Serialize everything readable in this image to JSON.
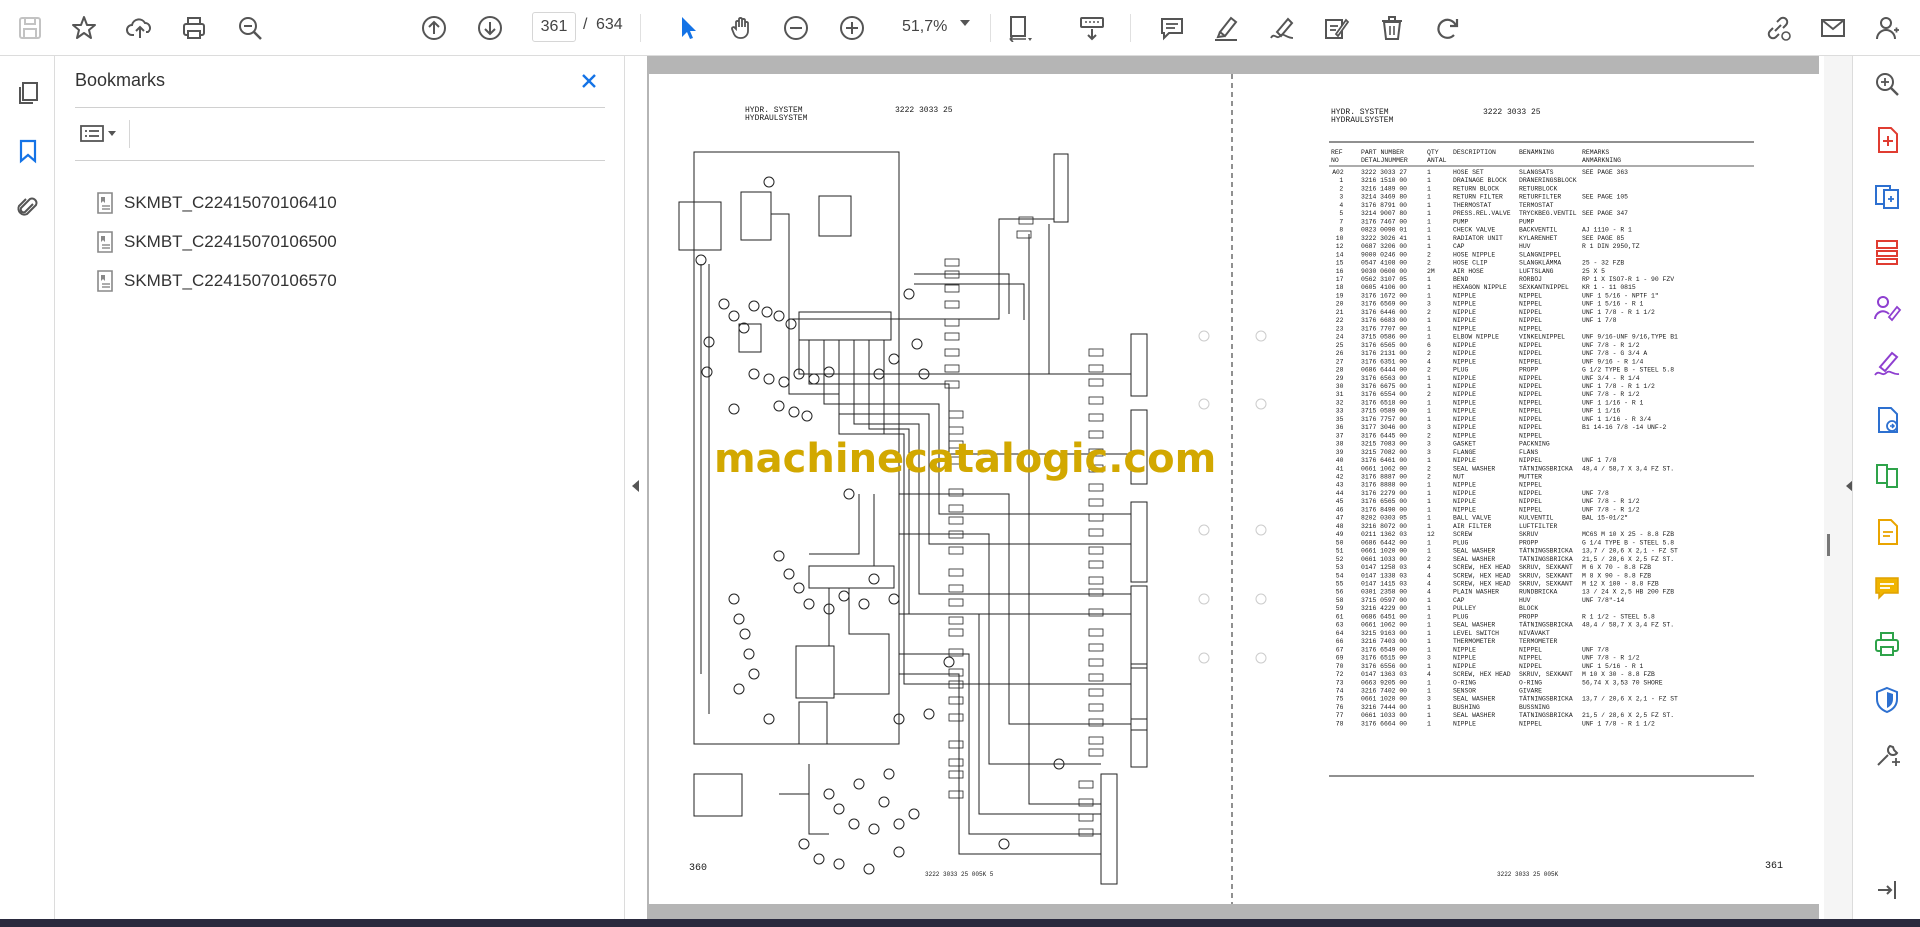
{
  "toolbar": {
    "page_current": "361",
    "page_separator": "/",
    "page_total": "634",
    "zoom": "51,7%"
  },
  "bookmarks": {
    "title": "Bookmarks",
    "items": [
      {
        "label": "SKMBT_C22415070106410"
      },
      {
        "label": "SKMBT_C22415070106500"
      },
      {
        "label": "SKMBT_C22415070106570"
      }
    ]
  },
  "document": {
    "watermark": "machinecatalogic.com",
    "left_page": {
      "header1": "HYDR. SYSTEM",
      "header2": "HYDRAULSYSTEM",
      "part_ref": "3222 3033 25",
      "page_number": "360",
      "footer": "3222 3033 25   005K   5"
    },
    "right_page": {
      "header1": "HYDR. SYSTEM",
      "header2": "HYDRAULSYSTEM",
      "part_ref": "3222 3033 25",
      "page_number": "361",
      "footer": "3222 3033 25   005K",
      "columns": [
        "REF NO",
        "PART NUMBER DETALJNUMMER",
        "QTY ANTAL",
        "DESCRIPTION",
        "BENÄMNING",
        "REMARKS ANMÄRKNING"
      ],
      "rows": [
        [
          "A02",
          "3222 3033 27",
          "1",
          "HOSE SET",
          "SLANGSATS",
          "SEE PAGE 363"
        ],
        [
          "1",
          "3216 1510 00",
          "1",
          "DRAINAGE BLOCK",
          "DRÄNERINGSBLOCK",
          ""
        ],
        [
          "2",
          "3216 1489 00",
          "1",
          "RETURN BLOCK",
          "RETURBLOCK",
          ""
        ],
        [
          "3",
          "3214 3469 80",
          "1",
          "RETURN FILTER",
          "RETURFILTER",
          "SEE PAGE 105"
        ],
        [
          "4",
          "3176 8791 00",
          "1",
          "THERMOSTAT",
          "TERMOSTAT",
          ""
        ],
        [
          "5",
          "3214 9007 80",
          "1",
          "PRESS.REL.VALVE",
          "TRYCKBEG.VENTIL",
          "SEE PAGE 347"
        ],
        [
          "7",
          "3176 7467 00",
          "1",
          "PUMP",
          "PUMP",
          ""
        ],
        [
          "8",
          "0823 0090 01",
          "1",
          "CHECK VALVE",
          "BACKVENTIL",
          "AJ 1110 - R 1"
        ],
        [
          "10",
          "3222 3026 41",
          "1",
          "RADIATOR UNIT",
          "KYLARENHET",
          "SEE PAGE 85"
        ],
        [
          "12",
          "0687 3206 00",
          "1",
          "CAP",
          "HUV",
          "R 1 DIN 2950,TZ"
        ],
        [
          "14",
          "9000 0246 00",
          "2",
          "HOSE NIPPLE",
          "SLANGNIPPEL",
          ""
        ],
        [
          "15",
          "0547 4108 00",
          "2",
          "HOSE CLIP",
          "SLANGKLÄMMA",
          "25 - 32 FZB"
        ],
        [
          "16",
          "9030 0600 00",
          "2M",
          "AIR HOSE",
          "LUFTSLANG",
          "25  X 5"
        ],
        [
          "17",
          "0562 3107 05",
          "1",
          "BEND",
          "RÖRBÖJ",
          "RP 1 X ISO7-R 1 - 90 FZV"
        ],
        [
          "18",
          "0605 4106 00",
          "1",
          "HEXAGON NIPPLE",
          "SEXKANTNIPPEL",
          "KR 1 - 11 0815"
        ],
        [
          "19",
          "3176 1672 00",
          "1",
          "NIPPLE",
          "NIPPEL",
          "UNF 1 5/16 - NPTF 1\""
        ],
        [
          "20",
          "3176 6569 00",
          "3",
          "NIPPLE",
          "NIPPEL",
          "UNF 1 5/16 - R 1"
        ],
        [
          "21",
          "3176 6446 00",
          "2",
          "NIPPLE",
          "NIPPEL",
          "UNF 1 7/8 - R 1 1/2"
        ],
        [
          "22",
          "3176 6683 00",
          "1",
          "NIPPLE",
          "NIPPEL",
          "UNF 1 7/8"
        ],
        [
          "23",
          "3176 7707 00",
          "1",
          "NIPPLE",
          "NIPPEL",
          ""
        ],
        [
          "24",
          "3715 0586 00",
          "1",
          "ELBOW NIPPLE",
          "VINKELNIPPEL",
          "UNF 9/16-UNF 9/16,TYPE B1"
        ],
        [
          "25",
          "3176 6565 00",
          "6",
          "NIPPLE",
          "NIPPEL",
          "UNF 7/8 - R 1/2"
        ],
        [
          "26",
          "3176 2131 00",
          "2",
          "NIPPLE",
          "NIPPEL",
          "UNF 7/8 - G 3/4 A"
        ],
        [
          "27",
          "3176 6351 00",
          "4",
          "NIPPLE",
          "NIPPEL",
          "UNF 9/16 - R 1/4"
        ],
        [
          "28",
          "0686 6444 00",
          "2",
          "PLUG",
          "PROPP",
          "G 1/2 TYPE B - STEEL 5.8"
        ],
        [
          "29",
          "3176 6563 00",
          "1",
          "NIPPLE",
          "NIPPEL",
          "UNF 3/4 - R 1/4"
        ],
        [
          "30",
          "3176 6675 00",
          "1",
          "NIPPLE",
          "NIPPEL",
          "UNF 1 7/8 - R 1 1/2"
        ],
        [
          "31",
          "3176 6554 00",
          "2",
          "NIPPLE",
          "NIPPEL",
          "UNF 7/8 - R 1/2"
        ],
        [
          "32",
          "3176 6518 00",
          "1",
          "NIPPLE",
          "NIPPEL",
          "UNF 1 1/16 - R 1"
        ],
        [
          "33",
          "3715 0589 00",
          "1",
          "NIPPLE",
          "NIPPEL",
          "UNF 1 1/16"
        ],
        [
          "35",
          "3176 7757 00",
          "1",
          "NIPPLE",
          "NIPPEL",
          "UNF 1 1/16 - R 3/4"
        ],
        [
          "36",
          "3177 3046 00",
          "3",
          "NIPPLE",
          "NIPPEL",
          "B1  14-16   7/8 -14 UNF-2"
        ],
        [
          "37",
          "3176 6445 00",
          "2",
          "NIPPLE",
          "NIPPEL",
          ""
        ],
        [
          "38",
          "3215 7083 00",
          "3",
          "GASKET",
          "PACKNING",
          ""
        ],
        [
          "39",
          "3215 7082 00",
          "3",
          "FLANGE",
          "FLÄNS",
          ""
        ],
        [
          "40",
          "3176 6461 00",
          "1",
          "NIPPLE",
          "NIPPEL",
          "UNF 1 7/8"
        ],
        [
          "41",
          "0661 1062 00",
          "2",
          "SEAL WASHER",
          "TÄTNINGSBRICKA",
          "48,4 / 58,7 X 3,4 FZ ST."
        ],
        [
          "42",
          "3176 8887 00",
          "2",
          "NUT",
          "MUTTER",
          ""
        ],
        [
          "43",
          "3176 8888 00",
          "1",
          "NIPPLE",
          "NIPPEL",
          ""
        ],
        [
          "44",
          "3176 2279 00",
          "1",
          "NIPPLE",
          "NIPPEL",
          "UNF 7/8"
        ],
        [
          "45",
          "3176 6565 00",
          "1",
          "NIPPLE",
          "NIPPEL",
          "UNF 7/8 - R 1/2"
        ],
        [
          "46",
          "3176 8490 00",
          "1",
          "NIPPLE",
          "NIPPEL",
          "UNF 7/8 - R 1/2"
        ],
        [
          "47",
          "8202 0303 05",
          "1",
          "BALL VALVE",
          "KULVENTIL",
          "BAL 15-01/2\""
        ],
        [
          "48",
          "3216 8072 00",
          "1",
          "AIR FILTER",
          "LUFTFILTER",
          ""
        ],
        [
          "49",
          "0211 1362 03",
          "12",
          "SCREW",
          "SKRUV",
          "MC6S M 10 X 25 - 8.8 FZB"
        ],
        [
          "50",
          "0686 6442 00",
          "1",
          "PLUG",
          "PROPP",
          "G 1/4 TYPE B - STEEL 5.8"
        ],
        [
          "51",
          "0661 1020 00",
          "1",
          "SEAL WASHER",
          "TÄTNINGSBRICKA",
          "13,7 / 20,6 X 2,1 - FZ ST"
        ],
        [
          "52",
          "0661 1033 00",
          "2",
          "SEAL WASHER",
          "TÄTNINGSBRICKA",
          "21,5 / 28,6 X 2,5 FZ ST."
        ],
        [
          "53",
          "0147 1258 03",
          "4",
          "SCREW, HEX HEAD",
          "SKRUV, SEXKANT",
          "M 6 X 70 - 8.8 FZB"
        ],
        [
          "54",
          "0147 1338 03",
          "4",
          "SCREW, HEX HEAD",
          "SKRUV, SEXKANT",
          "M 8 X 90 - 8.8 FZB"
        ],
        [
          "55",
          "0147 1415 03",
          "4",
          "SCREW, HEX HEAD",
          "SKRUV, SEXKANT",
          "M 12 X 100 - 8.8 FZB"
        ],
        [
          "56",
          "0301 2358 00",
          "4",
          "PLAIN WASHER",
          "RUNDBRICKA",
          "13 / 24 X 2,5 HB 200 FZB"
        ],
        [
          "58",
          "3715 0597 00",
          "1",
          "CAP",
          "HUV",
          "UNF 7/8\"-14"
        ],
        [
          "59",
          "3216 4229 00",
          "1",
          "PULLEY",
          "BLOCK",
          ""
        ],
        [
          "61",
          "0686 6451 00",
          "1",
          "PLUG",
          "PROPP",
          "R 1 1/2 - STEEL 5.8"
        ],
        [
          "63",
          "0661 1062 00",
          "1",
          "SEAL WASHER",
          "TÄTNINGSBRICKA",
          "48,4 / 58,7 X 3,4 FZ ST."
        ],
        [
          "64",
          "3215 9163 00",
          "1",
          "LEVEL SWITCH",
          "NIVÅVAKT",
          ""
        ],
        [
          "66",
          "3216 7403 00",
          "1",
          "THERMOMETER",
          "TERMOMETER",
          ""
        ],
        [
          "67",
          "3176 6549 00",
          "1",
          "NIPPLE",
          "NIPPEL",
          "UNF 7/8"
        ],
        [
          "69",
          "3176 6515 00",
          "3",
          "NIPPLE",
          "NIPPEL",
          "UNF 7/8 - R 1/2"
        ],
        [
          "70",
          "3176 6556 00",
          "1",
          "NIPPLE",
          "NIPPEL",
          "UNF 1 5/16 - R 1"
        ],
        [
          "72",
          "0147 1363 03",
          "4",
          "SCREW, HEX HEAD",
          "SKRUV, SEXKANT",
          "M 10 X 30 - 8.8 FZB"
        ],
        [
          "73",
          "0663 9205 00",
          "1",
          "O-RING",
          "O-RING",
          "56,74 X 3,53 70 SHORE"
        ],
        [
          "74",
          "3216 7402 00",
          "1",
          "SENSOR",
          "GIVARE",
          ""
        ],
        [
          "75",
          "0661 1020 00",
          "3",
          "SEAL WASHER",
          "TÄTNINGSBRICKA",
          "13,7 / 20,6 X 2,1 - FZ ST"
        ],
        [
          "76",
          "3216 7444 00",
          "1",
          "BUSHING",
          "BUSSNING",
          ""
        ],
        [
          "77",
          "0661 1033 00",
          "1",
          "SEAL WASHER",
          "TÄTNINGSBRICKA",
          "21,5 / 28,6 X 2,5 FZ ST."
        ],
        [
          "78",
          "3176 6664 00",
          "1",
          "NIPPLE",
          "NIPPEL",
          "UNF 1 7/8 - R 1 1/2"
        ]
      ]
    }
  }
}
